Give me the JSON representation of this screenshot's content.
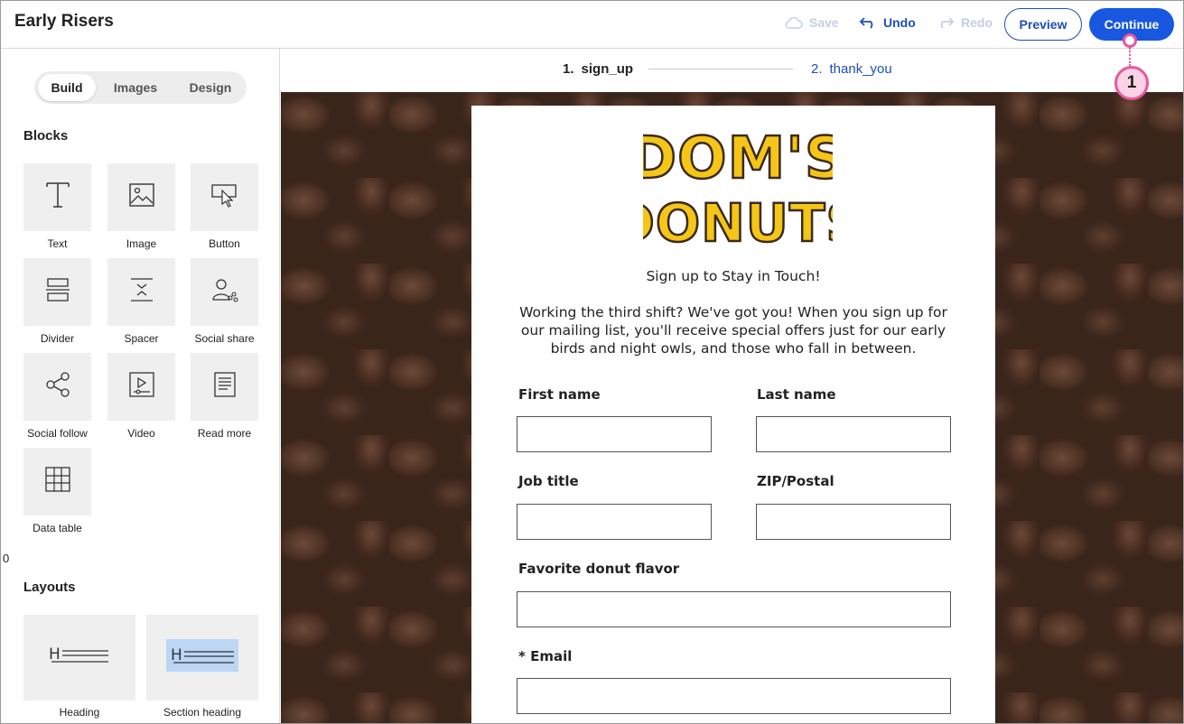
{
  "app": {
    "title": "Early Risers"
  },
  "toolbar": {
    "save": "Save",
    "undo": "Undo",
    "redo": "Redo",
    "preview": "Preview",
    "continue": "Continue"
  },
  "callout": {
    "number": "1",
    "color": "#e8589c"
  },
  "sidebar": {
    "tabs": [
      {
        "label": "Build",
        "selected": true
      },
      {
        "label": "Images",
        "selected": false
      },
      {
        "label": "Design",
        "selected": false
      }
    ],
    "blocks_title": "Blocks",
    "blocks": [
      {
        "label": "Text",
        "icon": "text-icon"
      },
      {
        "label": "Image",
        "icon": "image-icon"
      },
      {
        "label": "Button",
        "icon": "button-cursor-icon"
      },
      {
        "label": "Divider",
        "icon": "divider-icon"
      },
      {
        "label": "Spacer",
        "icon": "spacer-icon"
      },
      {
        "label": "Social share",
        "icon": "social-share-icon"
      },
      {
        "label": "Social follow",
        "icon": "social-follow-icon"
      },
      {
        "label": "Video",
        "icon": "video-icon"
      },
      {
        "label": "Read more",
        "icon": "read-more-icon"
      },
      {
        "label": "Data table",
        "icon": "data-table-icon"
      }
    ],
    "stray_text": "0",
    "layouts_title": "Layouts",
    "layouts": [
      {
        "label": "Heading",
        "icon": "heading-layout-icon"
      },
      {
        "label": "Section heading",
        "icon": "section-heading-layout-icon"
      }
    ]
  },
  "steps": [
    {
      "number": "1.",
      "label": "sign_up",
      "active": true
    },
    {
      "number": "2.",
      "label": "thank_you",
      "active": false
    }
  ],
  "form": {
    "logo": {
      "line1": "DOM'S",
      "line2": "DONUTS"
    },
    "heading": "Sign up to Stay in Touch!",
    "intro": "Working the third shift? We've got you! When you sign up for our mailing list, you'll receive special offers just for our early birds and night owls, and those who fall in between.",
    "fields": [
      {
        "label": "First name",
        "value": ""
      },
      {
        "label": "Last name",
        "value": ""
      },
      {
        "label": "Job title",
        "value": ""
      },
      {
        "label": "ZIP/Postal",
        "value": ""
      },
      {
        "label": "Favorite donut flavor",
        "value": ""
      },
      {
        "label": "* Email",
        "value": ""
      }
    ]
  },
  "colors": {
    "primary": "#1857e0",
    "link": "#1f4fb7",
    "disabled": "#c3cfe2",
    "logo_yellow": "#f5c518",
    "logo_dark": "#3a2a1c"
  }
}
